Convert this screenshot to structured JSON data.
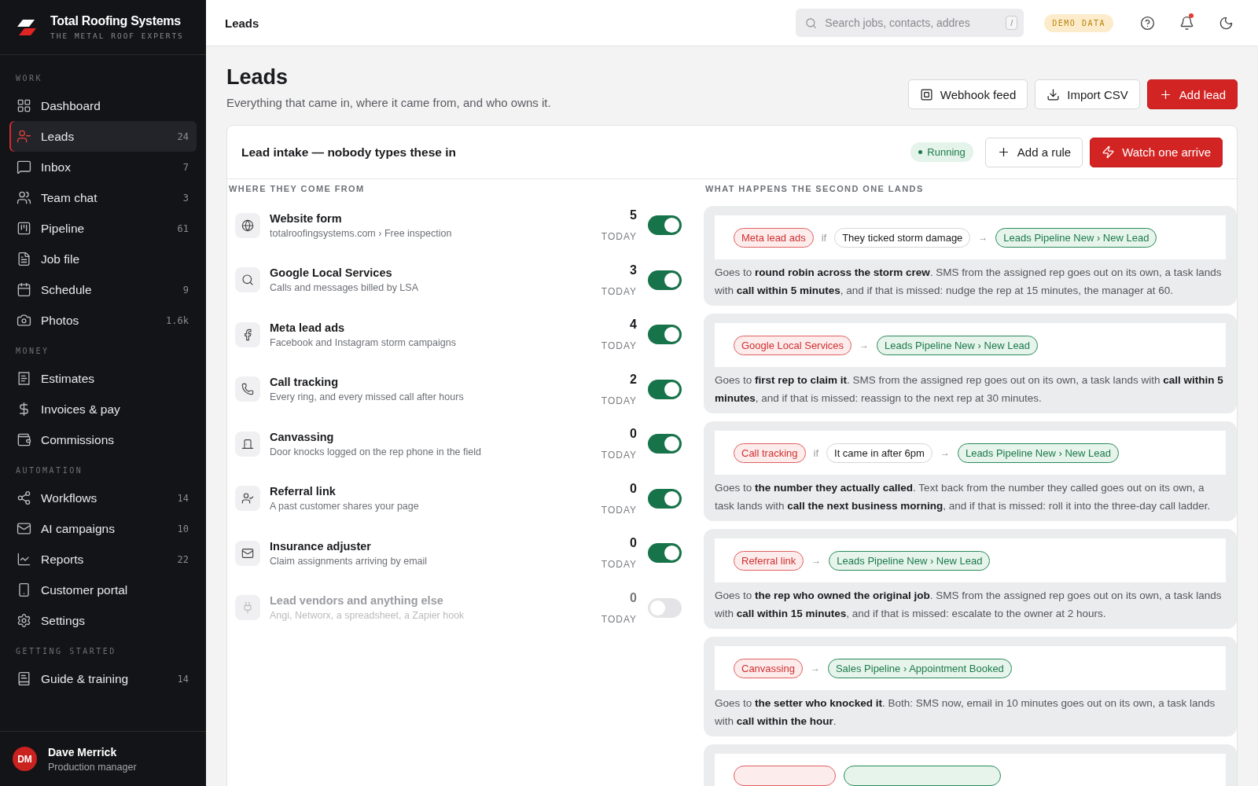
{
  "brand": {
    "name": "Total Roofing Systems",
    "tagline": "THE METAL ROOF EXPERTS"
  },
  "sidebar": {
    "sections": [
      {
        "title": "WORK",
        "items": [
          {
            "label": "Dashboard",
            "selected": false
          },
          {
            "label": "Leads",
            "count": "24",
            "selected": true
          },
          {
            "label": "Inbox",
            "count": "7",
            "selected": false
          },
          {
            "label": "Team chat",
            "count": "3",
            "selected": false
          },
          {
            "label": "Pipeline",
            "count": "61",
            "selected": false
          },
          {
            "label": "Job file",
            "selected": false
          },
          {
            "label": "Schedule",
            "count": "9",
            "selected": false
          },
          {
            "label": "Photos",
            "count": "1.6k",
            "selected": false
          }
        ]
      },
      {
        "title": "MONEY",
        "items": [
          {
            "label": "Estimates",
            "selected": false
          },
          {
            "label": "Invoices & pay",
            "selected": false
          },
          {
            "label": "Commissions",
            "selected": false
          }
        ]
      },
      {
        "title": "AUTOMATION",
        "items": [
          {
            "label": "Workflows",
            "count": "14",
            "selected": false
          },
          {
            "label": "AI campaigns",
            "count": "10",
            "selected": false
          },
          {
            "label": "Reports",
            "count": "22",
            "selected": false
          },
          {
            "label": "Customer portal",
            "selected": false
          },
          {
            "label": "Settings",
            "selected": false
          }
        ]
      },
      {
        "title": "GETTING STARTED",
        "items": [
          {
            "label": "Guide & training",
            "count": "14",
            "selected": false
          }
        ]
      }
    ]
  },
  "user": {
    "initials": "DM",
    "name": "Dave Merrick",
    "role": "Production manager"
  },
  "topbar": {
    "title": "Leads",
    "search": {
      "placeholder": "Search jobs, contacts, addres",
      "shortcut": "/"
    },
    "badge": "DEMO DATA",
    "unread": true
  },
  "page": {
    "title": "Leads",
    "subtitle": "Everything that came in, where it came from, and who owns it.",
    "actions": [
      {
        "label": "Webhook feed",
        "kind": "outline"
      },
      {
        "label": "Import CSV",
        "kind": "outline"
      },
      {
        "label": "Add lead",
        "kind": "primary"
      }
    ]
  },
  "intake": {
    "title": "Lead intake — nobody types these in",
    "status": "Running",
    "actions": [
      {
        "label": "Add a rule",
        "kind": "outline"
      },
      {
        "label": "Watch one arrive",
        "kind": "primary"
      }
    ],
    "sources": {
      "heading": "WHERE THEY COME FROM",
      "items": [
        {
          "name": "Website form",
          "detail": "totalroofingsystems.com › Free inspection",
          "count": "5",
          "period": "TODAY",
          "on": true
        },
        {
          "name": "Google Local Services",
          "detail": "Calls and messages billed by LSA",
          "count": "3",
          "period": "TODAY",
          "on": true
        },
        {
          "name": "Meta lead ads",
          "detail": "Facebook and Instagram storm campaigns",
          "count": "4",
          "period": "TODAY",
          "on": true
        },
        {
          "name": "Call tracking",
          "detail": "Every ring, and every missed call after hours",
          "count": "2",
          "period": "TODAY",
          "on": true
        },
        {
          "name": "Canvassing",
          "detail": "Door knocks logged on the rep phone in the field",
          "count": "0",
          "period": "TODAY",
          "on": true
        },
        {
          "name": "Referral link",
          "detail": "A past customer shares your page",
          "count": "0",
          "period": "TODAY",
          "on": true
        },
        {
          "name": "Insurance adjuster",
          "detail": "Claim assignments arriving by email",
          "count": "0",
          "period": "TODAY",
          "on": true
        },
        {
          "name": "Lead vendors and anything else",
          "detail": "Angi, Networx, a spreadsheet, a Zapier hook",
          "count": "0",
          "period": "TODAY",
          "on": false
        }
      ]
    },
    "rules": {
      "heading": "WHAT HAPPENS THE SECOND ONE LANDS",
      "items": [
        {
          "kind": "rule",
          "source": "Meta lead ads",
          "joiner": "if",
          "condition": "They ticked storm damage",
          "arrow": "→",
          "target": "Leads Pipeline New › New Lead",
          "text": "Goes to **round robin across the storm crew**. SMS from the assigned rep goes out on its own, a task lands with **call within 5 minutes**, and if that is missed: nudge the rep at 15 minutes, the manager at 60."
        },
        {
          "kind": "rule",
          "source": "Google Local Services",
          "arrow": "→",
          "target": "Leads Pipeline New › New Lead",
          "text": "Goes to **first rep to claim it**. SMS from the assigned rep goes out on its own, a task lands with **call within 5 minutes**, and if that is missed: reassign to the next rep at 30 minutes."
        },
        {
          "kind": "rule",
          "source": "Call tracking",
          "joiner": "if",
          "condition": "It came in after 6pm",
          "arrow": "→",
          "target": "Leads Pipeline New › New Lead",
          "text": "Goes to **the number they actually called**. Text back from the number they called goes out on its own, a task lands with **call the next business morning**, and if that is missed: roll it into the three-day call ladder."
        },
        {
          "kind": "rule",
          "source": "Referral link",
          "arrow": "→",
          "target": "Leads Pipeline New › New Lead",
          "text": "Goes to **the rep who owned the original job**. SMS from the assigned rep goes out on its own, a task lands with **call within 15 minutes**, and if that is missed: escalate to the owner at 2 hours."
        },
        {
          "kind": "rule",
          "source": "Canvassing",
          "arrow": "→",
          "target": "Sales Pipeline › Appointment Booked",
          "text": "Goes to **the setter who knocked it**. Both: SMS now, email in 10 minutes goes out on its own, a task lands with **call within the hour**."
        },
        {
          "kind": "clipped"
        }
      ]
    }
  }
}
